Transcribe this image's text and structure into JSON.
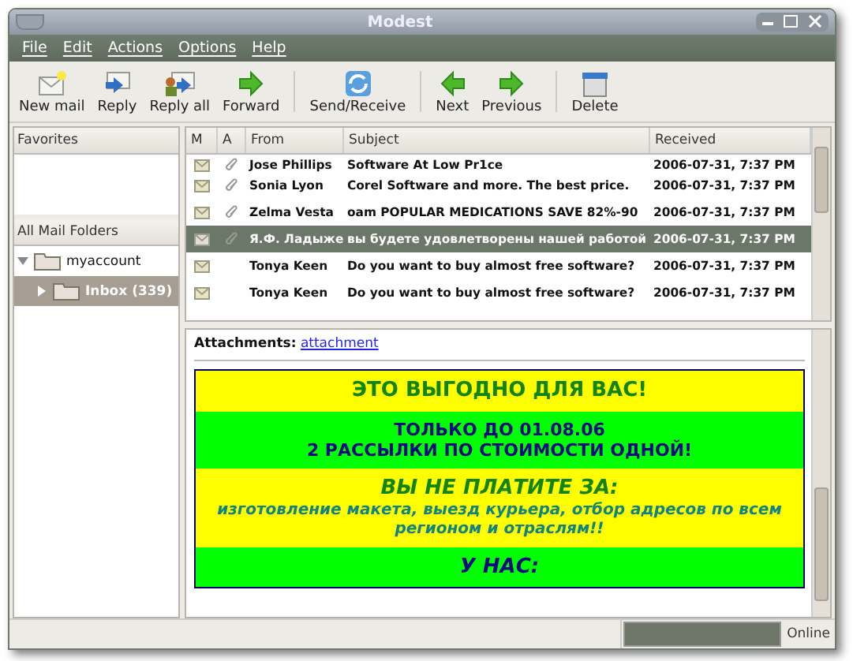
{
  "window": {
    "title": "Modest"
  },
  "menu": [
    "File",
    "Edit",
    "Actions",
    "Options",
    "Help"
  ],
  "toolbar": [
    [
      {
        "kind": "compose",
        "label": "New mail"
      },
      {
        "kind": "reply",
        "label": "Reply"
      },
      {
        "kind": "replyall",
        "label": "Reply all"
      },
      {
        "kind": "forward",
        "label": "Forward"
      }
    ],
    [
      {
        "kind": "sync",
        "label": "Send/Receive"
      }
    ],
    [
      {
        "kind": "left",
        "label": "Next"
      },
      {
        "kind": "right",
        "label": "Previous"
      }
    ],
    [
      {
        "kind": "delete",
        "label": "Delete"
      }
    ]
  ],
  "favorites": {
    "title": "Favorites"
  },
  "folders": {
    "title": "All Mail Folders",
    "tree": [
      {
        "name": "myaccount",
        "expanded": true,
        "selected": false,
        "children": [
          {
            "name": "Inbox (339)",
            "expanded": false,
            "selected": true
          }
        ]
      }
    ]
  },
  "messages": {
    "columns": [
      "M",
      "A",
      "From",
      "Subject",
      "Received"
    ],
    "rows": [
      {
        "from": "Jose Phillips",
        "subject": "Software At Low Pr1ce",
        "received": "2006-07-31, 7:37 PM",
        "attachment": true,
        "selected": false
      },
      {
        "from": "Sonia Lyon",
        "subject": "Corel Software and more. The best price.",
        "received": "2006-07-31, 7:37 PM",
        "attachment": true,
        "selected": false
      },
      {
        "from": "Zelma Vesta",
        "subject": "oam POPULAR MEDICATIONS SAVE 82%-90",
        "received": "2006-07-31, 7:37 PM",
        "attachment": true,
        "selected": false
      },
      {
        "from": "Я.Ф. Ладыже",
        "subject": "вы будете удовлетворены нашей работой",
        "received": "2006-07-31, 7:37 PM",
        "attachment": true,
        "selected": true
      },
      {
        "from": "Tonya Keen",
        "subject": "Do you want to buy almost free software?",
        "received": "2006-07-31, 7:37 PM",
        "attachment": false,
        "selected": false
      },
      {
        "from": "Tonya Keen",
        "subject": "Do you want to buy almost free software?",
        "received": "2006-07-31, 7:37 PM",
        "attachment": false,
        "selected": false
      }
    ]
  },
  "preview": {
    "attachments_label": "Attachments:",
    "attachment_link": "attachment",
    "blocks": [
      {
        "color": "#ffff00",
        "lines": [
          {
            "kind": "heading",
            "color": "#128412",
            "text": "ЭТО ВЫГОДНО ДЛЯ ВАС!"
          }
        ]
      },
      {
        "color": "#00ff00",
        "lines": [
          {
            "kind": "text",
            "color": "#0a0a80",
            "text": "ТОЛЬКО ДО 01.08.06"
          },
          {
            "kind": "text",
            "color": "#0a0a80",
            "text": "2 РАССЫЛКИ ПО СТОИМОСТИ ОДНОЙ!"
          }
        ]
      },
      {
        "color": "#ffff00",
        "lines": [
          {
            "kind": "subheading",
            "color": "#128412",
            "text": "ВЫ НЕ ПЛАТИТЕ ЗА:"
          },
          {
            "kind": "italic",
            "color": "#128480",
            "text": "изготовление макета, выезд курьера, отбор адресов по всем регионом и отраслям!!"
          }
        ]
      },
      {
        "color": "#00ff00",
        "lines": [
          {
            "kind": "subheading",
            "color": "#0a0a80",
            "text": "У НАС:"
          }
        ]
      }
    ]
  },
  "status_bar": {
    "connection": "Online"
  }
}
